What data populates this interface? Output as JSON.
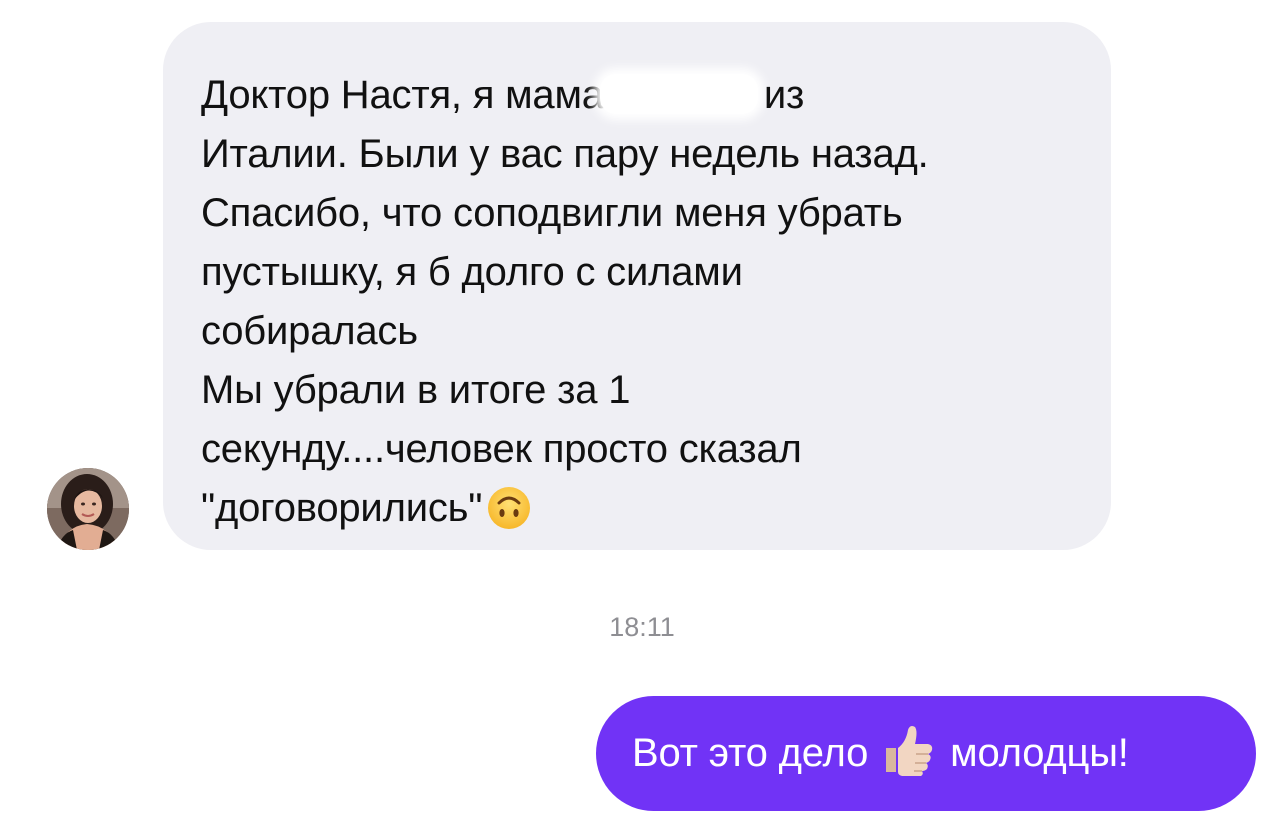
{
  "incoming_message": {
    "lines": [
      "Доктор Настя, я мама",
      "из",
      "Италии. Были у вас пару недель назад.",
      "Спасибо, что соподвигли меня убрать",
      "пустышку, я б долго с силами",
      "собиралась",
      "Мы убрали в итоге за 1",
      "секунду....человек просто сказал",
      "\"договорились\""
    ],
    "emoji": "upside-down-face"
  },
  "timestamp": "18:11",
  "outgoing_message": {
    "text_before": "Вот это дело",
    "emoji": "thumbs-up",
    "text_after": "молодцы!"
  },
  "colors": {
    "incoming_bubble": "#efeff4",
    "outgoing_bubble": "#7133f6",
    "timestamp_text": "#8e8e93"
  }
}
